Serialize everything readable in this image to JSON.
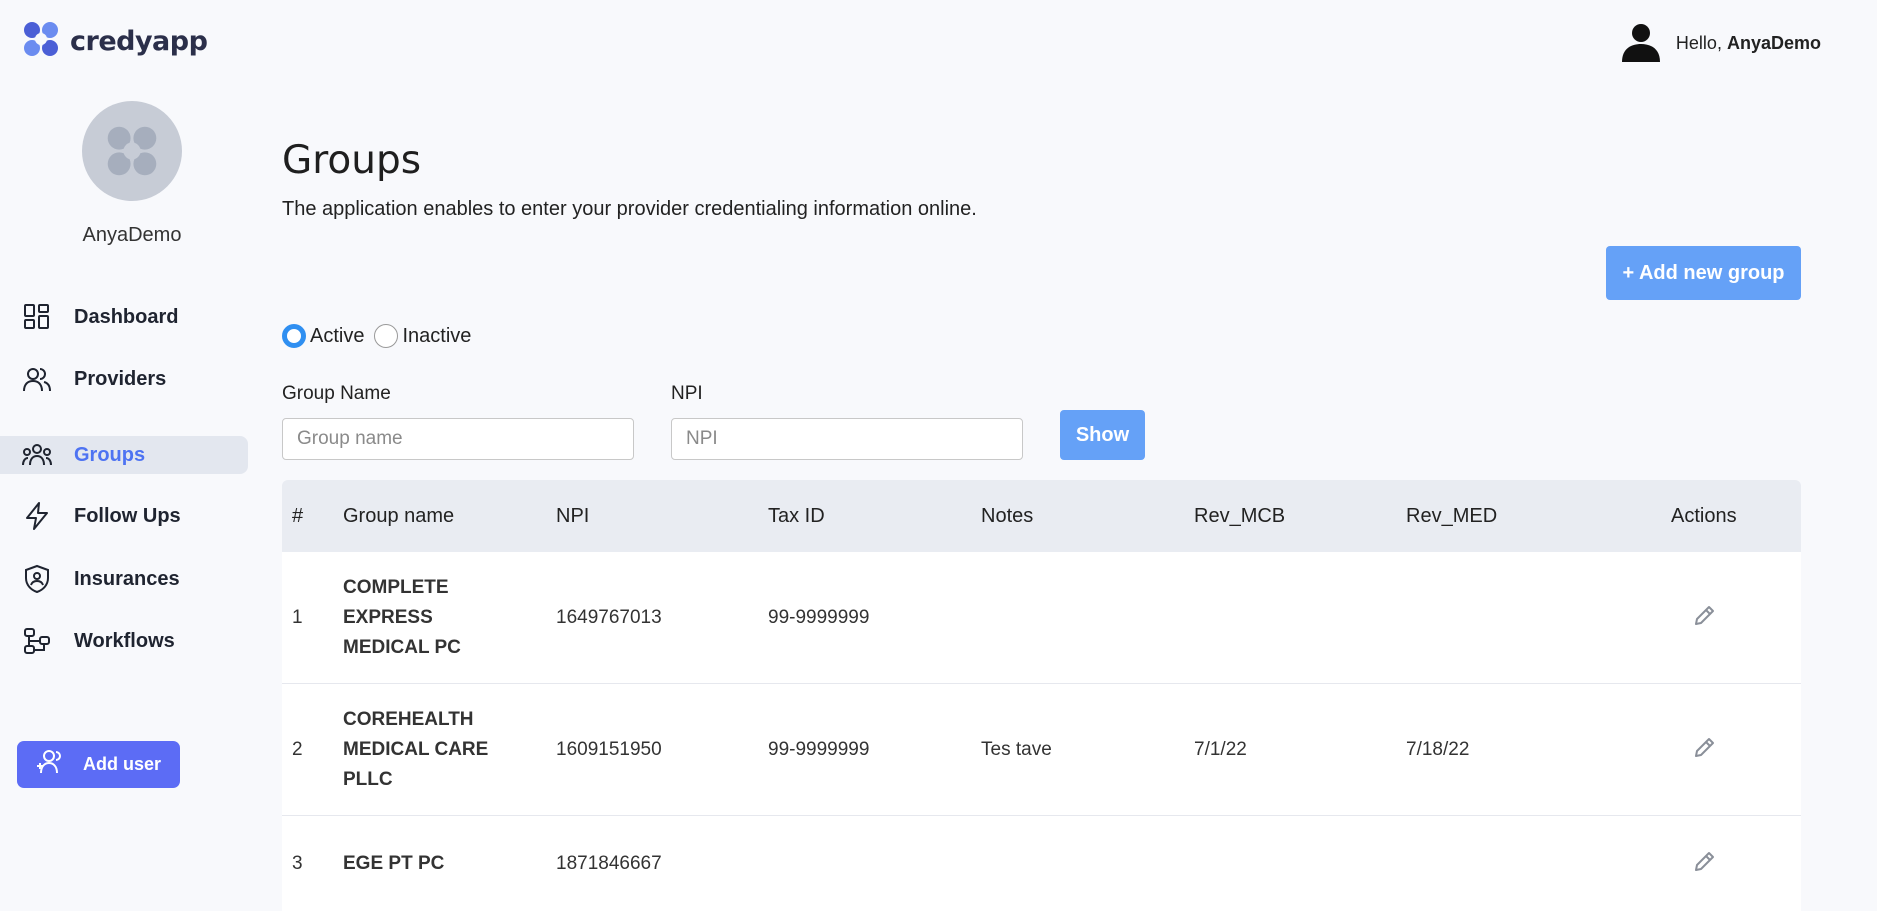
{
  "app": {
    "logo_text": "credyapp"
  },
  "header": {
    "greeting": "Hello,",
    "username": "AnyaDemo"
  },
  "sidebar": {
    "username": "AnyaDemo",
    "items": [
      {
        "label": "Dashboard",
        "icon": "dashboard-icon",
        "active": false
      },
      {
        "label": "Providers",
        "icon": "users-icon",
        "active": false
      },
      {
        "label": "Groups",
        "icon": "groups-icon",
        "active": true
      },
      {
        "label": "Follow Ups",
        "icon": "lightning-icon",
        "active": false
      },
      {
        "label": "Insurances",
        "icon": "shield-icon",
        "active": false
      },
      {
        "label": "Workflows",
        "icon": "workflow-icon",
        "active": false
      }
    ],
    "add_user_label": "Add user"
  },
  "main": {
    "title": "Groups",
    "subtitle": "The application enables to enter your provider credentialing information online.",
    "add_group_label": "+ Add new group",
    "filter": {
      "active_label": "Active",
      "inactive_label": "Inactive",
      "selected": "Active"
    },
    "search": {
      "group_name_label": "Group Name",
      "group_name_placeholder": "Group name",
      "npi_label": "NPI",
      "npi_placeholder": "NPI",
      "show_label": "Show"
    },
    "table": {
      "columns": [
        "#",
        "Group name",
        "NPI",
        "Tax ID",
        "Notes",
        "Rev_MCB",
        "Rev_MED",
        "Actions"
      ],
      "rows": [
        {
          "num": "1",
          "name": "COMPLETE EXPRESS MEDICAL PC",
          "npi": "1649767013",
          "tax_id": "99-9999999",
          "notes": "",
          "rev_mcb": "",
          "rev_med": ""
        },
        {
          "num": "2",
          "name": "COREHEALTH MEDICAL CARE PLLC",
          "npi": "1609151950",
          "tax_id": "99-9999999",
          "notes": "Tes tave",
          "rev_mcb": "7/1/22",
          "rev_med": "7/18/22"
        },
        {
          "num": "3",
          "name": "EGE PT PC",
          "npi": "1871846667",
          "tax_id": "",
          "notes": "",
          "rev_mcb": "",
          "rev_med": ""
        }
      ]
    }
  },
  "colors": {
    "accent": "#4e73f2",
    "button_blue": "#65a1f7",
    "add_user_purple": "#5c6cf5",
    "radio_blue": "#2f8ff1"
  }
}
